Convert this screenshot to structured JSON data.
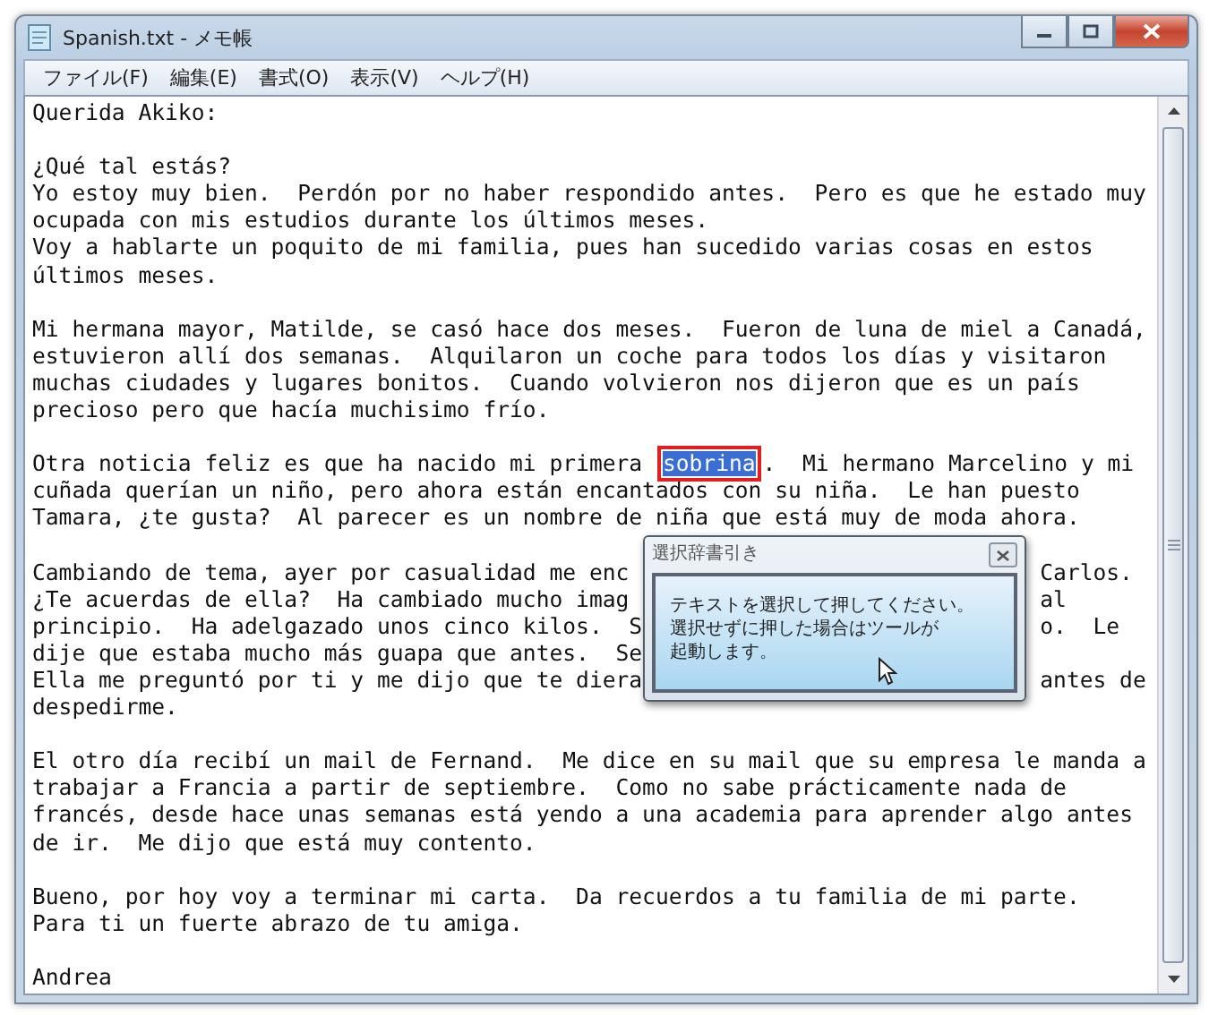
{
  "window": {
    "title": "Spanish.txt - メモ帳"
  },
  "menu": [
    {
      "label": "ファイル(F)"
    },
    {
      "label": "編集(E)"
    },
    {
      "label": "書式(O)"
    },
    {
      "label": "表示(V)"
    },
    {
      "label": "ヘルプ(H)"
    }
  ],
  "document": {
    "lines": [
      {
        "kind": "text",
        "text": "Querida Akiko:"
      },
      {
        "kind": "blank"
      },
      {
        "kind": "text",
        "text": "¿Qué tal estás?"
      },
      {
        "kind": "text",
        "text": "Yo estoy muy bien.  Perdón por no haber respondido antes.  Pero es que he estado muy"
      },
      {
        "kind": "text",
        "text": "ocupada con mis estudios durante los últimos meses."
      },
      {
        "kind": "text",
        "text": "Voy a hablarte un poquito de mi familia, pues han sucedido varias cosas en estos"
      },
      {
        "kind": "text",
        "text": "últimos meses."
      },
      {
        "kind": "blank"
      },
      {
        "kind": "text",
        "text": "Mi hermana mayor, Matilde, se casó hace dos meses.  Fueron de luna de miel a Canadá,"
      },
      {
        "kind": "text",
        "text": "estuvieron allí dos semanas.  Alquilaron un coche para todos los días y visitaron"
      },
      {
        "kind": "text",
        "text": "muchas ciudades y lugares bonitos.  Cuando volvieron nos dijeron que es un país"
      },
      {
        "kind": "text",
        "text": "precioso pero que hacía muchisimo frío."
      },
      {
        "kind": "blank"
      },
      {
        "kind": "selection",
        "segments": [
          {
            "text": "Otra noticia feliz es que ha nacido mi primera ",
            "selected": false
          },
          {
            "text": "sobrina",
            "selected": true
          },
          {
            "text": ".  Mi hermano Marcelino y mi",
            "selected": false
          }
        ]
      },
      {
        "kind": "text",
        "text": "cuñada querían un niño, pero ahora están encantados con su niña.  Le han puesto"
      },
      {
        "kind": "text",
        "text": "Tamara, ¿te gusta?  Al parecer es un nombre de niña que está muy de moda ahora."
      },
      {
        "kind": "blank"
      },
      {
        "kind": "split",
        "left": "Cambiando de tema, ayer por casualidad me enc",
        "right": "Carlos."
      },
      {
        "kind": "split",
        "left": "¿Te acuerdas de ella?  Ha cambiado mucho imag",
        "right": "al"
      },
      {
        "kind": "split",
        "left": "principio.  Ha adelgazado unos cinco kilos.  S",
        "right": "o.  Le"
      },
      {
        "kind": "text",
        "text": "dije que estaba mucho más guapa que antes.  Se"
      },
      {
        "kind": "split",
        "left": "Ella me preguntó por ti y me dijo que te diera",
        "right": "antes de"
      },
      {
        "kind": "text",
        "text": "despedirme."
      },
      {
        "kind": "blank"
      },
      {
        "kind": "text",
        "text": "El otro día recibí un mail de Fernand.  Me dice en su mail que su empresa le manda a"
      },
      {
        "kind": "text",
        "text": "trabajar a Francia a partir de septiembre.  Como no sabe prácticamente nada de"
      },
      {
        "kind": "text",
        "text": "francés, desde hace unas semanas está yendo a una academia para aprender algo antes"
      },
      {
        "kind": "text",
        "text": "de ir.  Me dijo que está muy contento."
      },
      {
        "kind": "blank"
      },
      {
        "kind": "text",
        "text": "Bueno, por hoy voy a terminar mi carta.  Da recuerdos a tu familia de mi parte."
      },
      {
        "kind": "text",
        "text": "Para ti un fuerte abrazo de tu amiga."
      },
      {
        "kind": "blank"
      },
      {
        "kind": "text",
        "text": "Andrea"
      }
    ]
  },
  "popup": {
    "title": "選択辞書引き",
    "message_lines": [
      "テキストを選択して押してください。",
      "選択せずに押した場合はツールが",
      "起動します。"
    ]
  }
}
